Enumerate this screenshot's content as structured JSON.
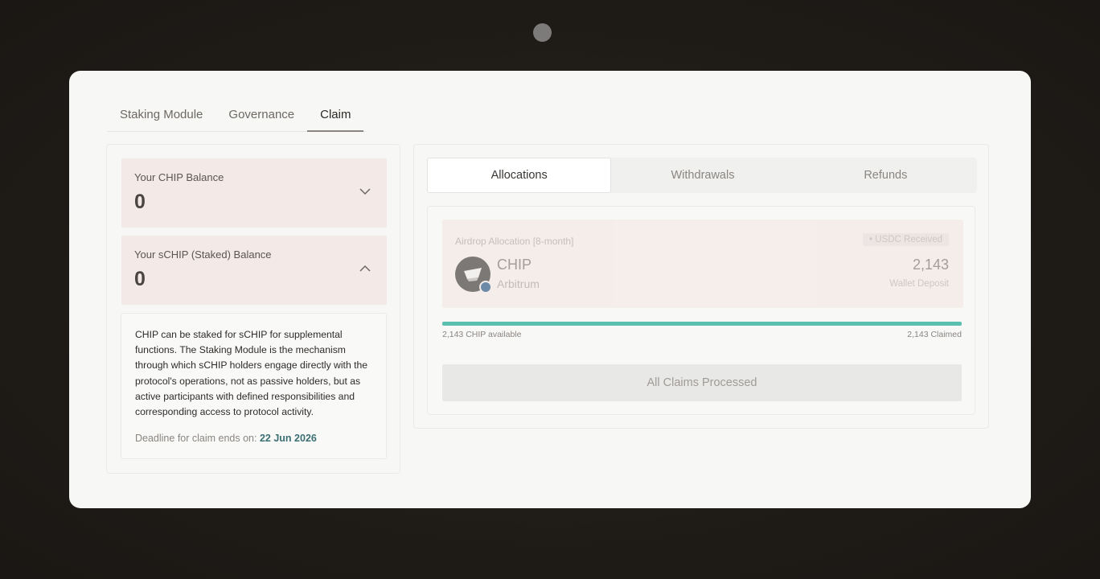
{
  "top_tabs": [
    {
      "label": "Staking Module",
      "active": false
    },
    {
      "label": "Governance",
      "active": false
    },
    {
      "label": "Claim",
      "active": true
    }
  ],
  "balances": {
    "chip": {
      "label": "Your CHIP Balance",
      "value": "0",
      "chevron": "chevron-down-icon"
    },
    "schip": {
      "label": "Your sCHIP (Staked) Balance",
      "value": "0",
      "chevron": "chevron-up-icon"
    }
  },
  "info": {
    "description": "CHIP can be staked for sCHIP for supplemental functions. The Staking Module is the mechanism through which sCHIP holders engage directly with the protocol's operations, not as passive holders, but as active participants with defined responsibilities and corresponding access to protocol activity.",
    "deadline_prefix": "Deadline for claim ends on:",
    "deadline_date": "22 Jun 2026"
  },
  "segment_tabs": [
    {
      "label": "Allocations",
      "active": true
    },
    {
      "label": "Withdrawals",
      "active": false
    },
    {
      "label": "Refunds",
      "active": false
    }
  ],
  "allocation": {
    "title": "Airdrop Allocation [8-month]",
    "badge": "• USDC Received",
    "token_name": "CHIP",
    "token_chain": "Arbitrum",
    "amount": "2,143",
    "amount_label": "Wallet Deposit",
    "progress_fraction": 1.0,
    "available_label": "2,143 CHIP available",
    "claimed_label": "2,143 Claimed",
    "button_label": "All Claims Processed"
  },
  "colors": {
    "accent_teal": "#5bbfb0",
    "deadline_date": "#3b6f73",
    "card_pink": "#f3e9e6"
  }
}
